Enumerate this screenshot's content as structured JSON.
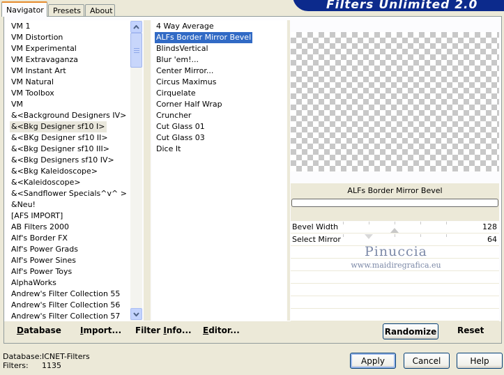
{
  "tabs": [
    {
      "label": "Navigator"
    },
    {
      "label": "Presets"
    },
    {
      "label": "About"
    }
  ],
  "banner": {
    "title": "Filters Unlimited 2.0"
  },
  "categories": [
    {
      "label": "VM 1"
    },
    {
      "label": "VM Distortion"
    },
    {
      "label": "VM Experimental"
    },
    {
      "label": "VM Extravaganza"
    },
    {
      "label": "VM Instant Art"
    },
    {
      "label": "VM Natural"
    },
    {
      "label": "VM Toolbox"
    },
    {
      "label": "VM"
    },
    {
      "label": "&<Background Designers IV>"
    },
    {
      "label": "&<Bkg Designer sf10 I>",
      "selected": true
    },
    {
      "label": "&<BKg Designer sf10 II>"
    },
    {
      "label": "&<Bkg Designer sf10 III>"
    },
    {
      "label": "&<Bkg Designers sf10 IV>"
    },
    {
      "label": "&<Bkg Kaleidoscope>"
    },
    {
      "label": "&<Kaleidoscope>"
    },
    {
      "label": "&<Sandflower Specials^v^ >"
    },
    {
      "label": "&Neu!"
    },
    {
      "label": "[AFS IMPORT]"
    },
    {
      "label": "AB Filters 2000"
    },
    {
      "label": "Alf's Border FX"
    },
    {
      "label": "Alf's Power Grads"
    },
    {
      "label": "Alf's Power Sines"
    },
    {
      "label": "Alf's Power Toys"
    },
    {
      "label": "AlphaWorks"
    },
    {
      "label": "Andrew's Filter Collection 55"
    },
    {
      "label": "Andrew's Filter Collection 56"
    },
    {
      "label": "Andrew's Filter Collection 57"
    }
  ],
  "filters": [
    {
      "label": "4 Way Average"
    },
    {
      "label": "ALFs Border Mirror Bevel",
      "selected": true
    },
    {
      "label": "BlindsVertical"
    },
    {
      "label": "Blur 'em!..."
    },
    {
      "label": "Center Mirror..."
    },
    {
      "label": "Circus Maximus"
    },
    {
      "label": "Cirquelate"
    },
    {
      "label": "Corner Half Wrap"
    },
    {
      "label": "Cruncher"
    },
    {
      "label": "Cut Glass 01"
    },
    {
      "label": "Cut Glass 03"
    },
    {
      "label": "Dice It"
    }
  ],
  "preview": {
    "filter_name": "ALFs Border Mirror Bevel"
  },
  "params": [
    {
      "label": "Bevel Width",
      "value": "128",
      "level": 0.5
    },
    {
      "label": "Select Mirror",
      "value": "64",
      "level": 0.25
    }
  ],
  "watermark": {
    "name": "Pinuccia",
    "site": "www.maidiregrafica.eu"
  },
  "toolbar": {
    "database": {
      "accel": "D",
      "rest": "atabase"
    },
    "import": {
      "accel": "I",
      "rest": "mport..."
    },
    "filter_info": {
      "pre": "Filter ",
      "accel": "I",
      "rest": "nfo..."
    },
    "editor": {
      "accel": "E",
      "rest": "ditor..."
    },
    "randomize": "Randomize",
    "reset": "Reset"
  },
  "status": {
    "database_label": "Database:",
    "database_value": "ICNET-Filters",
    "filters_label": "Filters:",
    "filters_value": "1135"
  },
  "actions": {
    "apply": "Apply",
    "cancel": "Cancel",
    "help": "Help"
  }
}
